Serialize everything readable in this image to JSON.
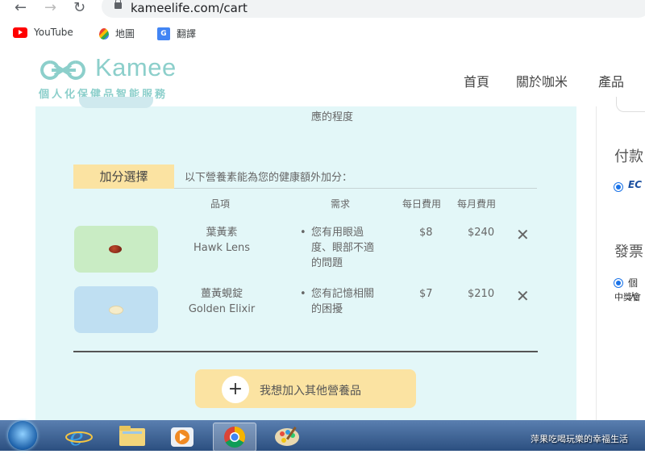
{
  "browser": {
    "url": "kameelife.com/cart",
    "bookmarks": [
      {
        "label": "YouTube",
        "icon": "youtube-icon"
      },
      {
        "label": "地圖",
        "icon": "maps-icon"
      },
      {
        "label": "翻譯",
        "icon": "translate-icon"
      }
    ]
  },
  "site": {
    "logo_text": "Kamee",
    "tagline": "個人化保健品智能服務",
    "nav": [
      "首頁",
      "關於咖米",
      "產品"
    ]
  },
  "cart": {
    "prev_item_text": "應的程度",
    "bonus_tag": "加分選擇",
    "bonus_desc": "以下營養素能為您的健康額外加分：",
    "headers": {
      "item": "品項",
      "need": "需求",
      "daily": "每日費用",
      "monthly": "每月費用"
    },
    "items": [
      {
        "name_zh": "葉黃素",
        "name_en": "Hawk Lens",
        "need": [
          "您有用眼過",
          "度、眼部不適",
          "的問題"
        ],
        "daily": "$8",
        "monthly": "$240",
        "image_bg": "#c9ecc4"
      },
      {
        "name_zh": "薑黃蜆錠",
        "name_en": "Golden Elixir",
        "need": [
          "您有記憶相關",
          "的困擾"
        ],
        "daily": "$7",
        "monthly": "$210",
        "image_bg": "#bfdff2"
      }
    ],
    "add_button": "我想加入其他營養品"
  },
  "right": {
    "payment_label": "付款",
    "payment_option": "EC",
    "invoice_label": "發票",
    "invoice_option": "個人",
    "invoice_sub": "中獎會"
  },
  "taskbar": {
    "watermark": "萍果吃喝玩樂的幸福生活"
  },
  "colors": {
    "accent": "#8ccfcb",
    "panel": "#e3f7f8",
    "yellow": "#fbe3a2"
  }
}
